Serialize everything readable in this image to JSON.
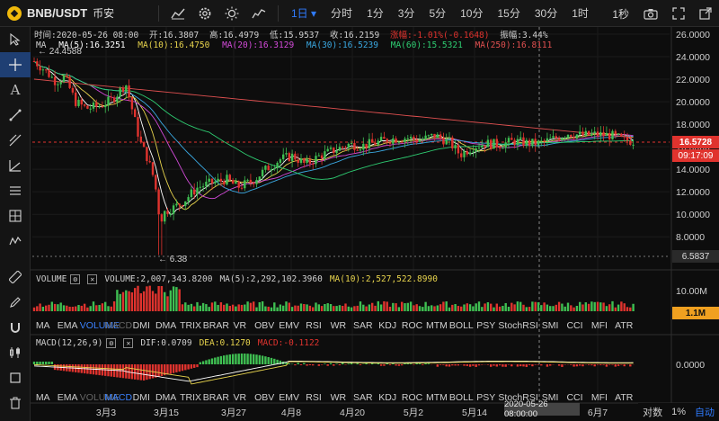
{
  "toolbar": {
    "symbol": "BNB/USDT",
    "exchange": "币安",
    "intervals": [
      "1日",
      "分时",
      "1分",
      "3分",
      "5分",
      "10分",
      "15分",
      "30分",
      "1时"
    ],
    "active_interval": "1日",
    "right_label": "1秒"
  },
  "info": {
    "time_label": "时间:2020-05-26 08:00",
    "open": "开:16.3807",
    "high": "高:16.4979",
    "low": "低:15.9537",
    "close": "收:16.2159",
    "change": "涨幅:-1.01%(-0.1648)",
    "amplitude": "振幅:3.44%"
  },
  "ma": {
    "label": "MA",
    "ma5": "MA(5):16.3251",
    "ma10": "MA(10):16.4750",
    "ma20": "MA(20):16.3129",
    "ma30": "MA(30):16.5239",
    "ma60": "MA(60):15.5321",
    "ma250": "MA(250):16.8111"
  },
  "colors": {
    "up": "#3fbf52",
    "down": "#e0332e",
    "ma5": "#ffffff",
    "ma10": "#e8d44d",
    "ma20": "#d24ad8",
    "ma30": "#3aa7e0",
    "ma60": "#2ecc71",
    "ma250": "#e05050",
    "accent": "#2f7bff"
  },
  "price_axis": {
    "labels": [
      "26.0000",
      "24.0000",
      "22.0000",
      "20.0000",
      "18.0000",
      "16.0000",
      "14.0000",
      "12.0000",
      "10.0000",
      "8.0000"
    ],
    "current_price": "16.5728",
    "countdown": "09:17:09",
    "low_price": "6.5837",
    "high_marker": "24.4588",
    "low_marker": "6.38"
  },
  "volume": {
    "label": "VOLUME",
    "value": "VOLUME:2,007,343.8200",
    "ma5": "MA(5):2,292,102.3960",
    "ma10": "MA(10):2,527,522.8990",
    "axis_label": "10.00M",
    "current_tag": "1.1M"
  },
  "macd": {
    "label": "MACD(12,26,9)",
    "dif": "DIF:0.0709",
    "dea": "DEA:0.1270",
    "macd": "MACD:-0.1122",
    "axis_label": "0.0000"
  },
  "indicator_tabs": [
    "MA",
    "EMA",
    "VOLUME",
    "MACD",
    "DMI",
    "DMA",
    "TRIX",
    "BRAR",
    "VR",
    "OBV",
    "EMV",
    "RSI",
    "WR",
    "SAR",
    "KDJ",
    "ROC",
    "MTM",
    "BOLL",
    "PSY",
    "StochRSI",
    "SMI",
    "CCI",
    "MFI",
    "ATR"
  ],
  "x_axis": {
    "labels": [
      "3月3",
      "3月15",
      "3月27",
      "4月8",
      "4月20",
      "5月2",
      "5月14",
      "6月7"
    ],
    "crosshair_date": "2020-05-26 08:00:00"
  },
  "bottom": {
    "log": "对数",
    "percent": "1%",
    "auto": "自动"
  }
}
